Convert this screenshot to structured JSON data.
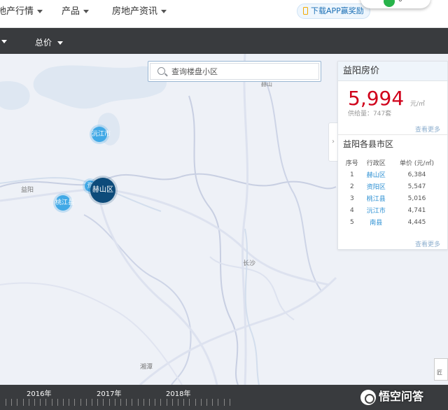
{
  "topnav": {
    "items": [
      {
        "label": "地产行情"
      },
      {
        "label": "产品"
      },
      {
        "label": "房地产资讯"
      }
    ],
    "app_button": "下载APP赢奖励",
    "user_badge": "0"
  },
  "filterbar": {
    "total_price": "总价"
  },
  "map": {
    "search_placeholder": "查询楼盘小区",
    "labels": {
      "yiyang": "益阳",
      "changsha": "长沙",
      "xiangtan": "湘潭",
      "taojiang": "桃江",
      "yuanjiang_place": "沅江",
      "heshan_place": "赫山"
    },
    "bubbles": {
      "yuanjiang": "沅江市",
      "heshan": "赫山区",
      "taojiang": "桃江县",
      "ziyang": "资"
    },
    "scale_label": "匠"
  },
  "panel": {
    "title": "益阳房价",
    "price": "5,994",
    "unit": "元/㎡",
    "supply": "供给量：747套",
    "more1": "查看更多",
    "districts_title": "益阳各县市区",
    "headers": [
      "序号",
      "行政区",
      "单价 (元/㎡)"
    ],
    "rows": [
      {
        "idx": "1",
        "name": "赫山区",
        "price": "6,384"
      },
      {
        "idx": "2",
        "name": "资阳区",
        "price": "5,547"
      },
      {
        "idx": "3",
        "name": "桃江县",
        "price": "5,016"
      },
      {
        "idx": "4",
        "name": "沅江市",
        "price": "4,741"
      },
      {
        "idx": "5",
        "name": "南县",
        "price": "4,445"
      }
    ],
    "more2": "查看更多",
    "toggle": "›"
  },
  "timeline": {
    "years": [
      "2016年",
      "2017年",
      "2018年"
    ]
  },
  "watermark": "悟空问答"
}
